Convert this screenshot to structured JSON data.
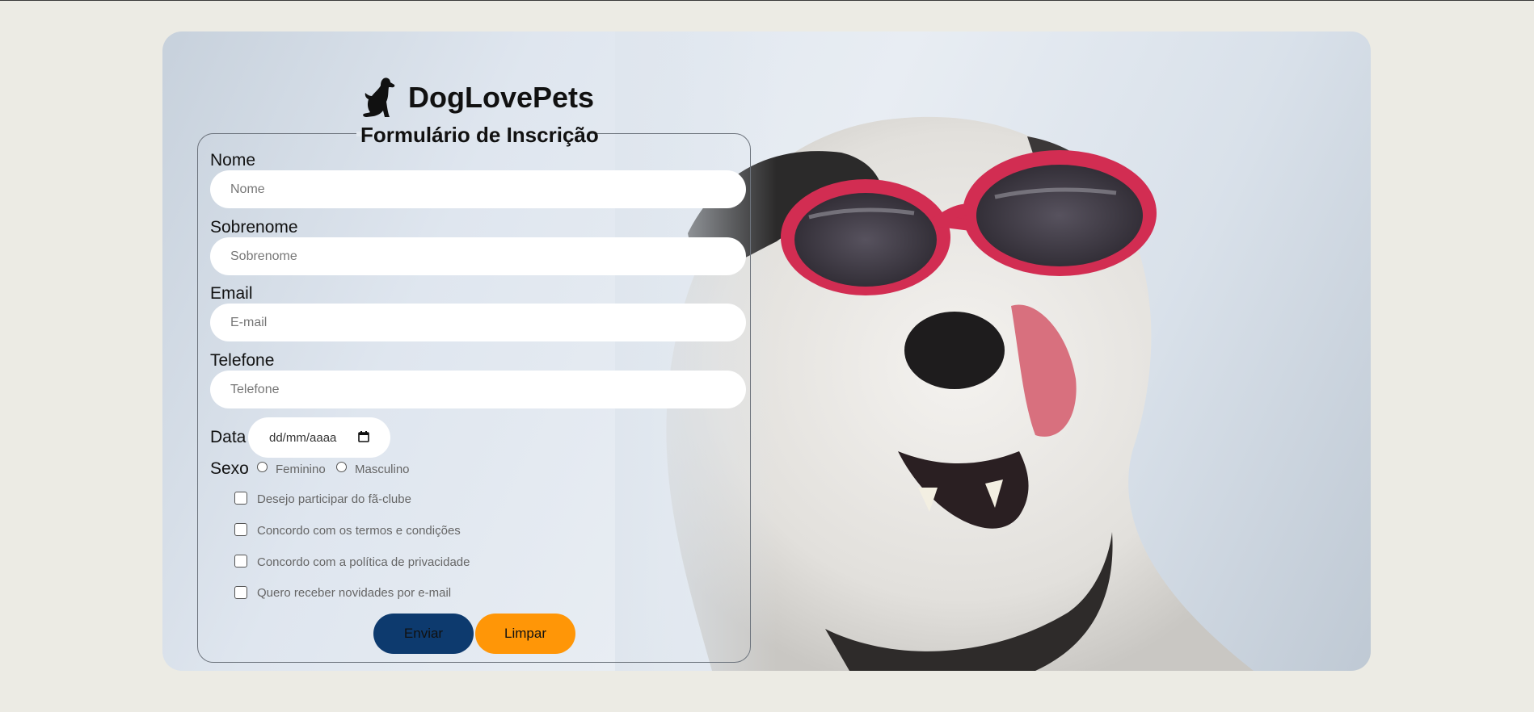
{
  "brand": {
    "name": "DogLovePets",
    "logo_icon": "dog-silhouette-icon"
  },
  "form": {
    "legend": "Formulário de Inscrição",
    "fields": [
      {
        "label": "Nome",
        "placeholder": "Nome"
      },
      {
        "label": "Sobrenome",
        "placeholder": "Sobrenome"
      },
      {
        "label": "Email",
        "placeholder": "E-mail"
      },
      {
        "label": "Telefone",
        "placeholder": "Telefone"
      }
    ],
    "date": {
      "label": "Data",
      "placeholder": "dd/mm/aaaa",
      "icon": "calendar-icon"
    },
    "sex": {
      "label": "Sexo",
      "options": [
        "Feminino",
        "Masculino"
      ]
    },
    "checkboxes": [
      "Desejo participar do fã-clube",
      "Concordo com os termos e condições",
      "Concordo com a política de privacidade",
      "Quero receber novidades por e-mail"
    ],
    "buttons": {
      "submit": "Enviar",
      "reset": "Limpar"
    }
  },
  "colors": {
    "page_background": "#ecebe4",
    "submit_button": "#0d3a6e",
    "reset_button": "#ff9607",
    "input_background": "#ffffff"
  }
}
